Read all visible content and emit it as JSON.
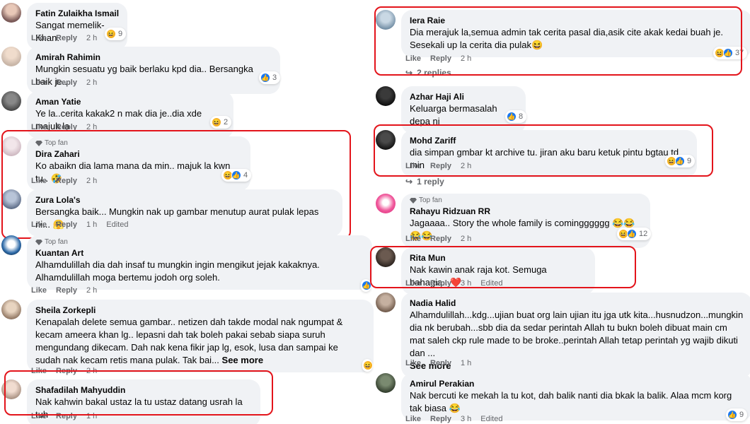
{
  "labels": {
    "like": "Like",
    "reply": "Reply",
    "edited": "Edited",
    "top_fan": "Top fan",
    "see_more": "See more"
  },
  "left": [
    {
      "id": "c1",
      "name": "Fatin Zulaikha Ismail",
      "text": "Sangat memelik-Khan.",
      "time": "2 h",
      "react_count": "9"
    },
    {
      "id": "c2",
      "name": "Amirah Rahimin",
      "text": "Mungkin sesuatu yg baik berlaku kpd dia.. Bersangka baik je..",
      "time": "2 h",
      "react_count": "3"
    },
    {
      "id": "c3",
      "name": "Aman Yatie",
      "text": "Ye la..cerita kakak2 n mak dia je..dia xde majuk la",
      "time": "2 h",
      "react_count": "2"
    },
    {
      "id": "c4",
      "name": "Dira Zahari",
      "text": "Ko abaikn dia lama mana da min.. majuk la kwn tu.. 🤣",
      "time": "2 h",
      "react_count": "4"
    },
    {
      "id": "c5",
      "name": "Zura Lola's",
      "text": "Bersangka baik... Mungkin nak up gambar menutup aurat pulak lepas ni... 🤗",
      "time": "1 h"
    },
    {
      "id": "c6",
      "name": "Kuantan Art",
      "text": "Alhamdulillah dia dah insaf tu mungkin ingin mengikut jejak kakaknya. Alhamdulillah moga bertemu jodoh org soleh.",
      "time": "2 h"
    },
    {
      "id": "c7",
      "name": "Sheila Zorkepli",
      "text": "Kenapalah delete semua gambar.. netizen dah takde modal nak ngumpat & kecam ameera khan lg.. lepasni dah tak boleh pakai sebab siapa suruh mengundang dikecam. Dah nak kena fikir jap lg, esok, lusa dan sampai ke sudah nak kecam retis mana pulak. Tak bai...",
      "time": "2 h"
    },
    {
      "id": "c8",
      "name": "Shafadilah Mahyuddin",
      "text": "Nak kahwin bakal ustaz la tu ustaz datang usrah la tuh",
      "time": "1 h"
    }
  ],
  "right": [
    {
      "id": "r1",
      "name": "Iera Raie",
      "text": "Dia merajuk la,semua admin tak cerita pasal dia,asik cite akak kedai buah je. Sesekali up la cerita dia pulak😆",
      "time": "2 h",
      "react_count": "37",
      "replies": "2 replies"
    },
    {
      "id": "r2",
      "name": "Azhar Haji Ali",
      "text": "Keluarga bermasalah depa ni",
      "time": "2 h",
      "react_count": "8"
    },
    {
      "id": "r3",
      "name": "Mohd Zariff",
      "text": "dia simpan gmbar kt archive tu. jiran aku baru ketuk pintu bgtau td min",
      "time": "2 h",
      "react_count": "9",
      "replies": "1 reply"
    },
    {
      "id": "r4",
      "name": "Rahayu Ridzuan RR",
      "text": "Jagaaaa.. Story the whole family is comingggggg 😂😂😂😂",
      "time": "2 h",
      "react_count": "12"
    },
    {
      "id": "r5",
      "name": "Rita Mun",
      "text": "Nak kawin anak raja kot. Semuga bahagia.. ❤️",
      "time": "3 h"
    },
    {
      "id": "r6",
      "name": "Nadia Halid",
      "text": "Alhamdulillah...kdg...ujian buat org lain ujian itu jga utk kita...husnudzon...mungkin dia nk berubah...sbb dia da sedar perintah Allah tu bukn boleh dibuat main cm mat saleh ckp rule made to be broke..perintah Allah tetap perintah yg wajib dikuti dan ...",
      "time": "1 h"
    },
    {
      "id": "r7",
      "name": "Amirul Perakian",
      "text": "Nak bercuti ke mekah la tu kot, dah balik nanti dia bkak la balik. Alaa mcm korg tak biasa 😂",
      "time": "3 h",
      "react_count": "9"
    }
  ],
  "colors": {
    "highlight": "#e3141b",
    "bubble": "#f0f2f5",
    "meta": "#65676b",
    "like": "#1877f2",
    "haha": "#f7b125",
    "love": "#f33e58"
  }
}
